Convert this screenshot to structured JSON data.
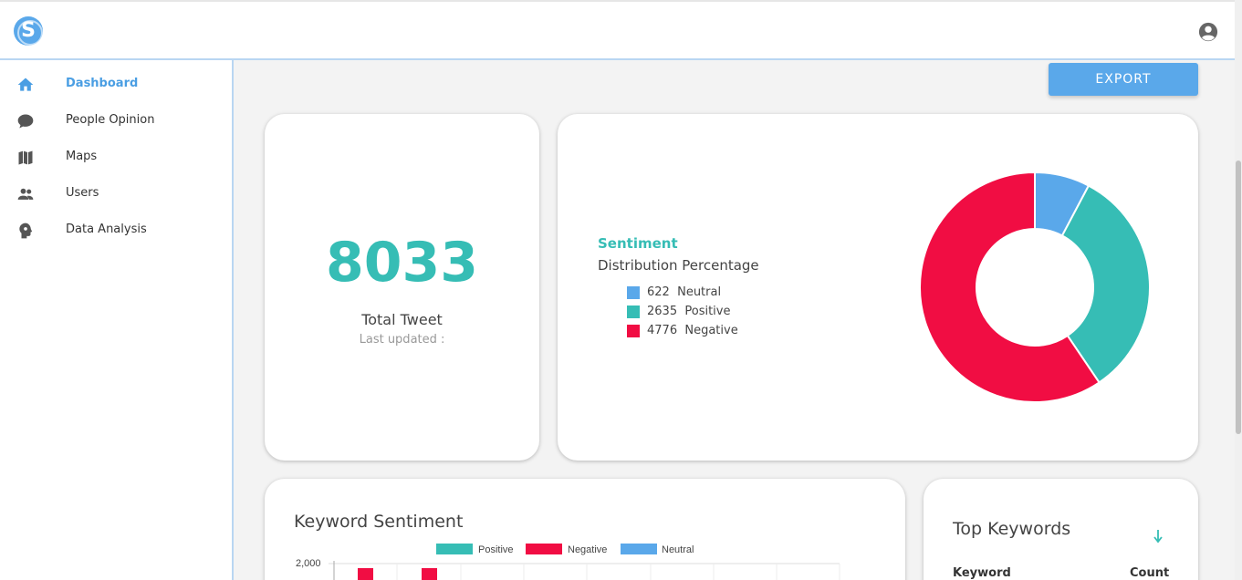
{
  "header": {
    "logo_letter": "S",
    "account_icon": "account-circle-icon"
  },
  "sidebar": {
    "items": [
      {
        "label": "Dashboard",
        "icon": "home-icon",
        "active": true
      },
      {
        "label": "People Opinion",
        "icon": "chat-bubble-icon",
        "active": false
      },
      {
        "label": "Maps",
        "icon": "map-icon",
        "active": false
      },
      {
        "label": "Users",
        "icon": "users-icon",
        "active": false
      },
      {
        "label": "Data Analysis",
        "icon": "brain-gear-icon",
        "active": false
      }
    ]
  },
  "toolbar": {
    "export_label": "EXPORT"
  },
  "total": {
    "value": "8033",
    "label": "Total Tweet",
    "updated": "Last updated :"
  },
  "sentiment": {
    "title": "Sentiment",
    "subtitle": "Distribution Percentage",
    "legend": [
      {
        "count": "622",
        "label": "Neutral",
        "color": "#5aa8ea"
      },
      {
        "count": "2635",
        "label": "Positive",
        "color": "#36bdb5"
      },
      {
        "count": "4776",
        "label": "Negative",
        "color": "#f10d43"
      }
    ]
  },
  "chart_data": {
    "type": "pie",
    "title": "Sentiment",
    "categories": [
      "Neutral",
      "Positive",
      "Negative"
    ],
    "values": [
      622,
      2635,
      4776
    ],
    "colors": [
      "#5aa8ea",
      "#36bdb5",
      "#f10d43"
    ]
  },
  "keyword_sentiment": {
    "title": "Keyword Sentiment",
    "legend": [
      {
        "label": "Positive",
        "color": "#36bdb5"
      },
      {
        "label": "Negative",
        "color": "#f10d43"
      },
      {
        "label": "Neutral",
        "color": "#5aa8ea"
      }
    ],
    "y_tick": "2,000"
  },
  "top_keywords": {
    "title": "Top Keywords",
    "col_keyword": "Keyword",
    "col_count": "Count"
  },
  "colors": {
    "accent": "#5aa8ea",
    "teal": "#36bdb5",
    "red": "#f10d43"
  }
}
